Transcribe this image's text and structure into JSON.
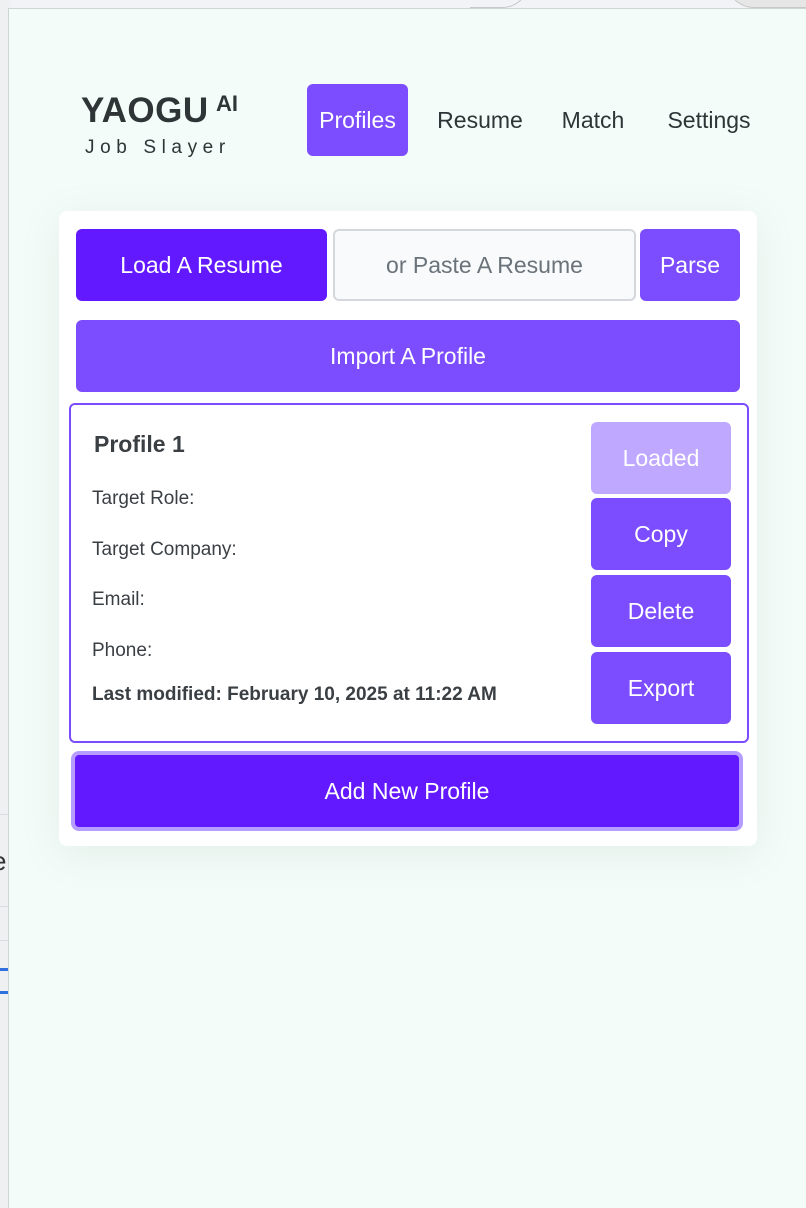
{
  "logo": {
    "main": "YAOGU",
    "ai": "AI",
    "tagline": "Job Slayer"
  },
  "nav": {
    "tabs": [
      {
        "label": "Profiles",
        "active": true
      },
      {
        "label": "Resume",
        "active": false
      },
      {
        "label": "Match",
        "active": false
      },
      {
        "label": "Settings",
        "active": false
      }
    ]
  },
  "actions": {
    "load_resume": "Load A Resume",
    "paste_placeholder": "or Paste A Resume",
    "parse": "Parse",
    "import_profile": "Import A Profile",
    "add_profile": "Add New Profile"
  },
  "profile": {
    "name": "Profile 1",
    "target_role_label": "Target Role:",
    "target_company_label": "Target Company:",
    "email_label": "Email:",
    "phone_label": "Phone:",
    "last_modified": "Last modified: February 10, 2025 at 11:22 AM",
    "buttons": {
      "loaded": "Loaded",
      "copy": "Copy",
      "delete": "Delete",
      "export": "Export"
    }
  },
  "colors": {
    "accent": "#7c4dff",
    "accent_dark": "#6319ff",
    "accent_light": "#bfa8ff",
    "popup_bg": "#f3fcf8"
  }
}
